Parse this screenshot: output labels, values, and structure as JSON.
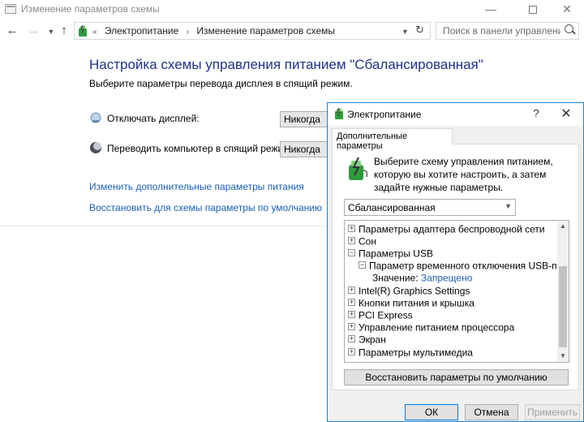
{
  "window": {
    "title": "Изменение параметров схемы",
    "minimize": "—",
    "close": "✕"
  },
  "nav": {
    "back": "←",
    "forward": "→",
    "up": "↑",
    "crumb_lead": "«",
    "breadcrumb": [
      "Электропитание",
      "Изменение параметров схемы"
    ],
    "breadcrumb_separator": "›",
    "refresh": "↻",
    "search_placeholder": "Поиск в панели управления"
  },
  "main": {
    "title": "Настройка схемы управления питанием \"Сбалансированная\"",
    "subtitle": "Выберите параметры перевода дисплея в спящий режим.",
    "display_off_label": "Отключать дисплей:",
    "display_off_value": "Никогда",
    "sleep_label": "Переводить компьютер в спящий режим:",
    "sleep_value": "Никогда",
    "link_advanced": "Изменить дополнительные параметры питания",
    "link_restore": "Восстановить для схемы параметры по умолчанию"
  },
  "dialog": {
    "title": "Электропитание",
    "help": "?",
    "close": "✕",
    "tab": "Дополнительные параметры",
    "intro": "Выберите схему управления питанием, которую вы хотите настроить, а затем задайте нужные параметры.",
    "plan": "Сбалансированная",
    "tree": [
      {
        "toggle": "+",
        "label": "Параметры адаптера беспроводной сети",
        "level": 0
      },
      {
        "toggle": "+",
        "label": "Сон",
        "level": 0
      },
      {
        "toggle": "−",
        "label": "Параметры USB",
        "level": 0
      },
      {
        "toggle": "−",
        "label": "Параметр временного отключения USB-порта",
        "level": 1
      },
      {
        "toggle": "",
        "label": "Значение:",
        "value": "Запрещено",
        "level": 2
      },
      {
        "toggle": "+",
        "label": "Intel(R) Graphics Settings",
        "level": 0
      },
      {
        "toggle": "+",
        "label": "Кнопки питания и крышка",
        "level": 0
      },
      {
        "toggle": "+",
        "label": "PCI Express",
        "level": 0
      },
      {
        "toggle": "+",
        "label": "Управление питанием процессора",
        "level": 0
      },
      {
        "toggle": "+",
        "label": "Экран",
        "level": 0
      },
      {
        "toggle": "+",
        "label": "Параметры мультимедиа",
        "level": 0
      }
    ],
    "restore_button": "Восстановить параметры по умолчанию",
    "ok": "ОК",
    "cancel": "Отмена",
    "apply": "Применить"
  },
  "colors": {
    "title_blue": "#1e3287",
    "link_blue": "#1a5fb4",
    "dialog_border": "#1883d7"
  }
}
